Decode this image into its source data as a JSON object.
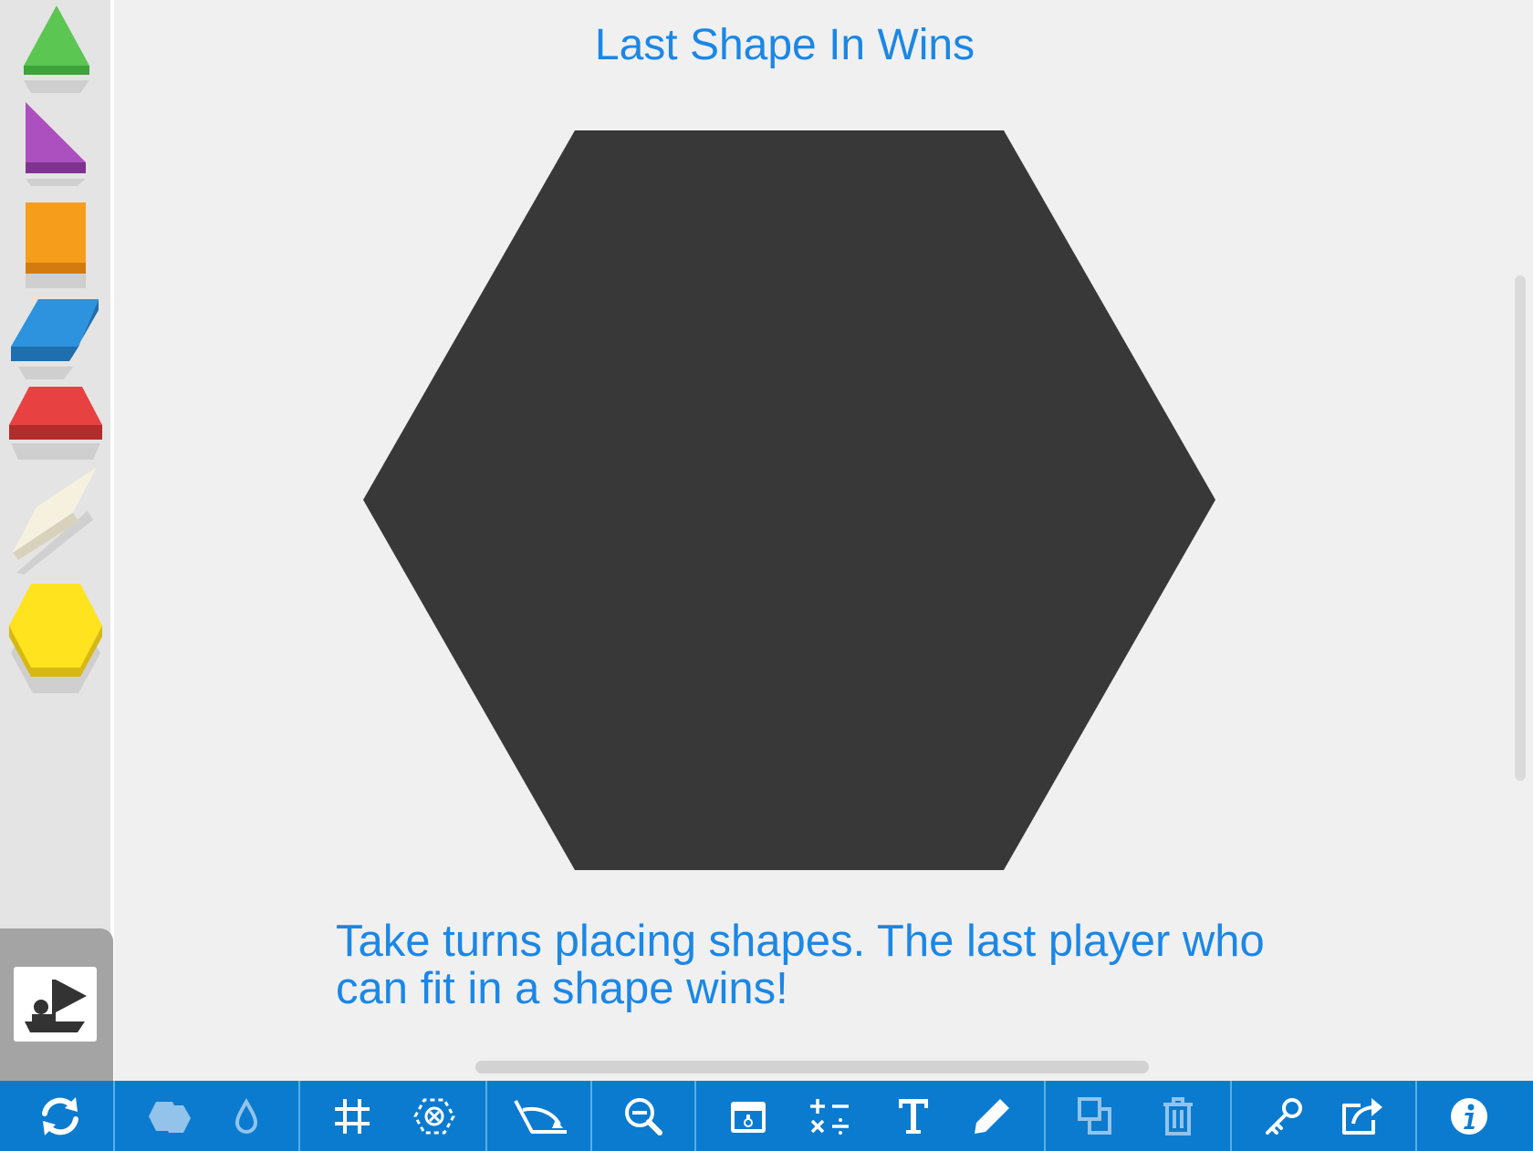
{
  "title": "Last Shape In Wins",
  "instructions": "Take turns placing shapes. The last player who can fit in a shape wins!",
  "palette": {
    "shapes": [
      {
        "icon": "green-triangle-icon",
        "color": "#55c24e"
      },
      {
        "icon": "purple-right-triangle-icon",
        "color": "#a64db8"
      },
      {
        "icon": "orange-square-icon",
        "color": "#f59a1a"
      },
      {
        "icon": "blue-rhombus-icon",
        "color": "#2c8fdb"
      },
      {
        "icon": "red-trapezoid-icon",
        "color": "#e53f3f"
      },
      {
        "icon": "tan-thin-rhombus-icon",
        "color": "#f4efdc"
      },
      {
        "icon": "yellow-hexagon-icon",
        "color": "#ffe11d"
      }
    ],
    "player_icon": "player-turn-flag-icon"
  },
  "board": {
    "shape": "hexagon-outline",
    "color": "#383838"
  },
  "toolbar": {
    "buttons": [
      "refresh-icon",
      "shapes-icon",
      "color-drop-icon",
      "grid-icon",
      "snap-icon",
      "rotate-icon",
      "zoom-out-icon",
      "photo-icon",
      "math-ops-icon",
      "text-icon",
      "pencil-icon",
      "duplicate-icon",
      "trash-icon",
      "key-icon",
      "share-icon",
      "info-icon"
    ]
  },
  "colors": {
    "accent": "#1b87e6",
    "toolbar": "#0b7bd0",
    "background": "#f0f0f0"
  }
}
